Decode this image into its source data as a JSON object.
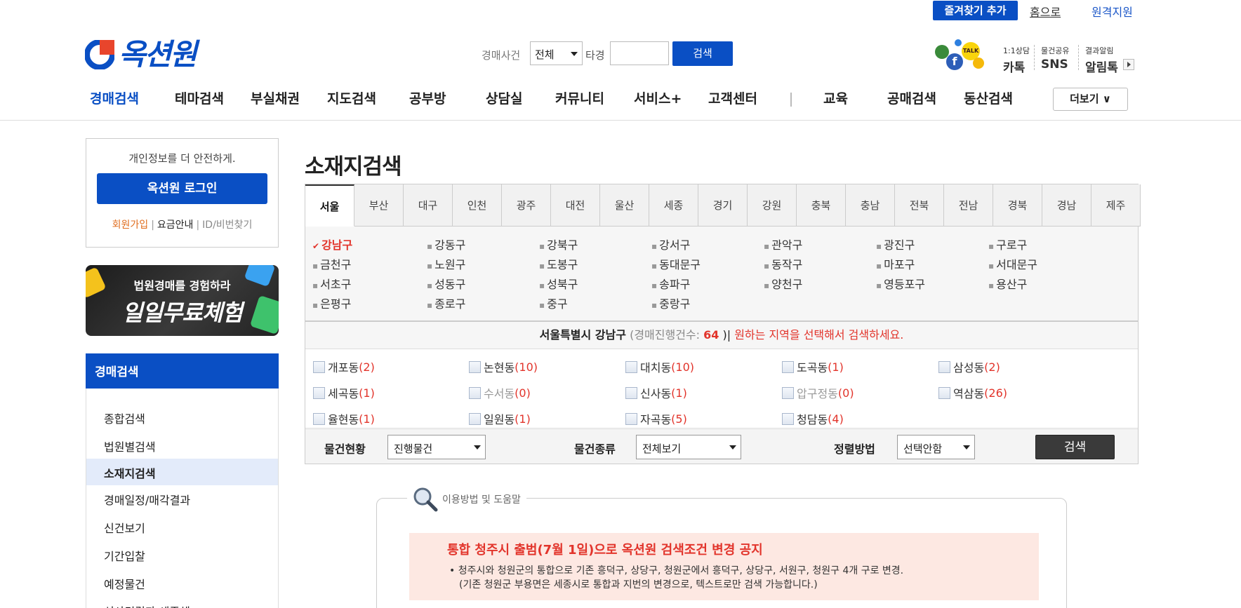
{
  "util": {
    "favorite_label": "즐겨찾기 추가",
    "home_label": "홈으로",
    "remote_label": "원격지원"
  },
  "logo": {
    "text": "옥션원"
  },
  "search": {
    "case_label": "경매사건",
    "type_value": "전체",
    "tagyeong_label": "타경",
    "tagyeong_value": "",
    "button_label": "검색"
  },
  "social": {
    "groups": [
      {
        "top": "1:1상담",
        "bottom": "카톡"
      },
      {
        "top": "물건공유",
        "bottom": "SNS"
      },
      {
        "top": "결과알림",
        "bottom": "알림톡"
      }
    ]
  },
  "nav": {
    "items": [
      "경매검색",
      "테마검색",
      "부실채권",
      "지도검색",
      "공부방",
      "상담실",
      "커뮤니티",
      "서비스+",
      "고객센터",
      "교육",
      "공매검색",
      "동산검색"
    ],
    "more_label": "더보기 ∨"
  },
  "sidebar": {
    "login_msg": "개인정보를 더 안전하게.",
    "login_button": "옥션원 로그인",
    "join": "회원가입",
    "fee": "요금안내",
    "find": "ID/비번찾기",
    "banner_line1": "법원경매를 경험하라",
    "banner_line2": "일일무료체험",
    "menu_title": "경매검색",
    "menu_items": [
      "종합검색",
      "법원별검색",
      "소재지검색",
      "경매일정/매각결과",
      "신건보기",
      "기간입찰",
      "예정물건",
      "신사건결과 세종체"
    ]
  },
  "main": {
    "title": "소재지검색",
    "tabs": [
      "서울",
      "부산",
      "대구",
      "인천",
      "광주",
      "대전",
      "울산",
      "세종",
      "경기",
      "강원",
      "충북",
      "충남",
      "전북",
      "전남",
      "경북",
      "경남",
      "제주"
    ],
    "districts": [
      "강남구",
      "강동구",
      "강북구",
      "강서구",
      "관악구",
      "광진구",
      "구로구",
      "금천구",
      "노원구",
      "도봉구",
      "동대문구",
      "동작구",
      "마포구",
      "서대문구",
      "서초구",
      "성동구",
      "성북구",
      "송파구",
      "양천구",
      "영등포구",
      "용산구",
      "은평구",
      "종로구",
      "중구",
      "중랑구"
    ],
    "info": {
      "region": "서울특별시 강남구",
      "count_label": "경매진행건수: ",
      "count": "64",
      "tail": "원하는 지역을 선택해서 검색하세요."
    },
    "dongs": [
      {
        "name": "개포동",
        "count": "(2)"
      },
      {
        "name": "논현동",
        "count": "(10)"
      },
      {
        "name": "대치동",
        "count": "(10)"
      },
      {
        "name": "도곡동",
        "count": "(1)"
      },
      {
        "name": "삼성동",
        "count": "(2)"
      },
      {
        "name": "세곡동",
        "count": "(1)"
      },
      {
        "name": "수서동",
        "count": "(0)"
      },
      {
        "name": "신사동",
        "count": "(1)"
      },
      {
        "name": "압구정동",
        "count": "(0)"
      },
      {
        "name": "역삼동",
        "count": "(26)"
      },
      {
        "name": "율현동",
        "count": "(1)"
      },
      {
        "name": "일원동",
        "count": "(1)"
      },
      {
        "name": "자곡동",
        "count": "(5)"
      },
      {
        "name": "청담동",
        "count": "(4)"
      }
    ],
    "filters": {
      "status_label": "물건현황",
      "status_value": "진행물건",
      "kind_label": "물건종류",
      "kind_value": "전체보기",
      "sort_label": "정렬방법",
      "sort_value": "선택안함",
      "button_label": "검색"
    }
  },
  "help": {
    "title": "이용방법 및 도움말",
    "notice_title": "통합 청주시 출범(7월 1일)으로 옥션원 검색조건 변경 공지",
    "notice_line1": "청주시와 청원군의 통합으로 기존 흥덕구, 상당구, 청원군에서 흥덕구, 상당구, 서원구, 청원구 4개 구로 변경.",
    "notice_line2": "(기존 청원군 부용면은 세종시로 통합과 지번의 변경으로, 텍스트로만 검색 가능합니다.)"
  },
  "colors": {
    "brand": "#0a4fc4",
    "accent_red": "#e2342b",
    "orange": "#e06c1c"
  }
}
